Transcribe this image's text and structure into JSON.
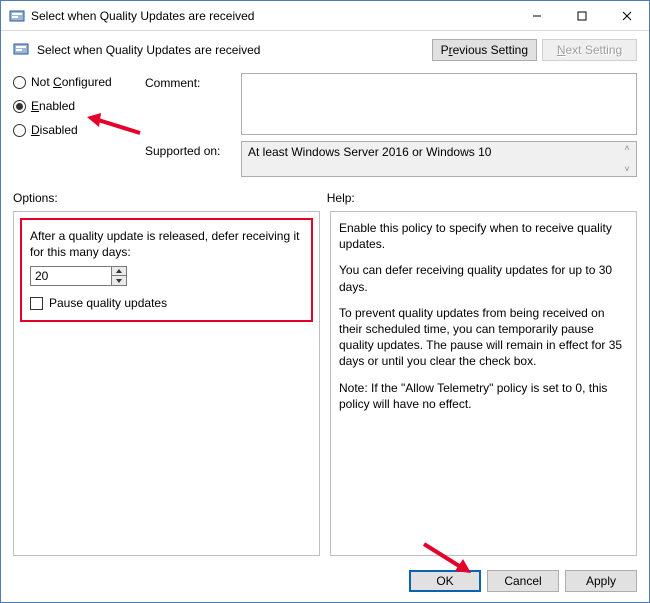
{
  "titlebar": {
    "title": "Select when Quality Updates are received"
  },
  "header": {
    "title": "Select when Quality Updates are received",
    "prev_label_pre": "P",
    "prev_label_ul": "r",
    "prev_label_post": "evious Setting",
    "next_label_pre": "",
    "next_label_ul": "N",
    "next_label_post": "ext Setting"
  },
  "radios": {
    "not_configured": {
      "pre": "Not ",
      "ul": "C",
      "post": "onfigured",
      "checked": false
    },
    "enabled": {
      "pre": "",
      "ul": "E",
      "post": "nabled",
      "checked": true
    },
    "disabled": {
      "pre": "",
      "ul": "D",
      "post": "isabled",
      "checked": false
    }
  },
  "fields": {
    "comment_label_pre": "Co",
    "comment_label_ul": "m",
    "comment_label_post": "ment:",
    "comment_value": "",
    "supported_label": "Supported on:",
    "supported_value": "At least Windows Server 2016 or Windows 10"
  },
  "sections": {
    "options_label": "Options:",
    "help_label": "Help:"
  },
  "options": {
    "defer_label": "After a quality update is released, defer receiving it for this many days:",
    "defer_value": "20",
    "pause_label": "Pause quality updates",
    "pause_checked": false
  },
  "help": {
    "p1": "Enable this policy to specify when to receive quality updates.",
    "p2": "You can defer receiving quality updates for up to 30 days.",
    "p3": "To prevent quality updates from being received on their scheduled time, you can temporarily pause quality updates. The pause will remain in effect for 35 days or until you clear the check box.",
    "p4": "Note: If the \"Allow Telemetry\" policy is set to 0, this policy will have no effect."
  },
  "footer": {
    "ok": "OK",
    "cancel": "Cancel",
    "apply_pre": "",
    "apply_ul": "A",
    "apply_post": "pply"
  }
}
